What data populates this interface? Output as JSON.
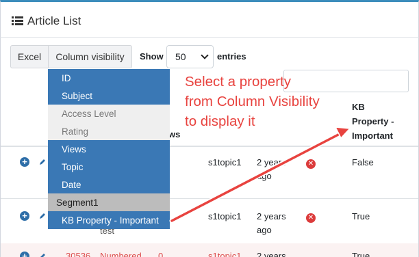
{
  "card": {
    "title": "Article List"
  },
  "toolbar": {
    "excel_label": "Excel",
    "colvis_label": "Column visibility",
    "show_label": "Show",
    "entries_value": "50",
    "entries_label": "entries"
  },
  "dropdown": {
    "items": [
      {
        "label": "ID",
        "state": "active"
      },
      {
        "label": "Subject",
        "state": "active"
      },
      {
        "label": "Access Level",
        "state": "inactive"
      },
      {
        "label": "Rating",
        "state": "inactive"
      },
      {
        "label": "Views",
        "state": "active"
      },
      {
        "label": "Topic",
        "state": "active"
      },
      {
        "label": "Date",
        "state": "active"
      },
      {
        "label": "Segment1",
        "state": "group"
      },
      {
        "label": "KB Property - Important",
        "state": "active"
      }
    ]
  },
  "annotation": {
    "line1": "Select a property",
    "line2": "from Column Visibility",
    "line3": "to display it",
    "color": "#e8433f"
  },
  "table": {
    "headers": {
      "views_partial": "ws",
      "kb_line1": "KB",
      "kb_line2": "Property -",
      "kb_line3": "Important"
    },
    "rows": [
      {
        "topic": "s1topic1",
        "date_line1": "2 years",
        "date_line2": "ago",
        "kb": "False"
      },
      {
        "subject_partial": "test",
        "topic": "s1topic1",
        "date_line1": "2 years",
        "date_line2": "ago",
        "kb": "True"
      },
      {
        "id": "30536",
        "subject": "Numbered",
        "views": "0",
        "topic": "s1topic1",
        "date": "2 years",
        "kb": "True"
      }
    ]
  },
  "colors": {
    "accent": "#3c8dbc",
    "dropdown_active": "#3a78b5",
    "danger": "#dc3c3c"
  }
}
